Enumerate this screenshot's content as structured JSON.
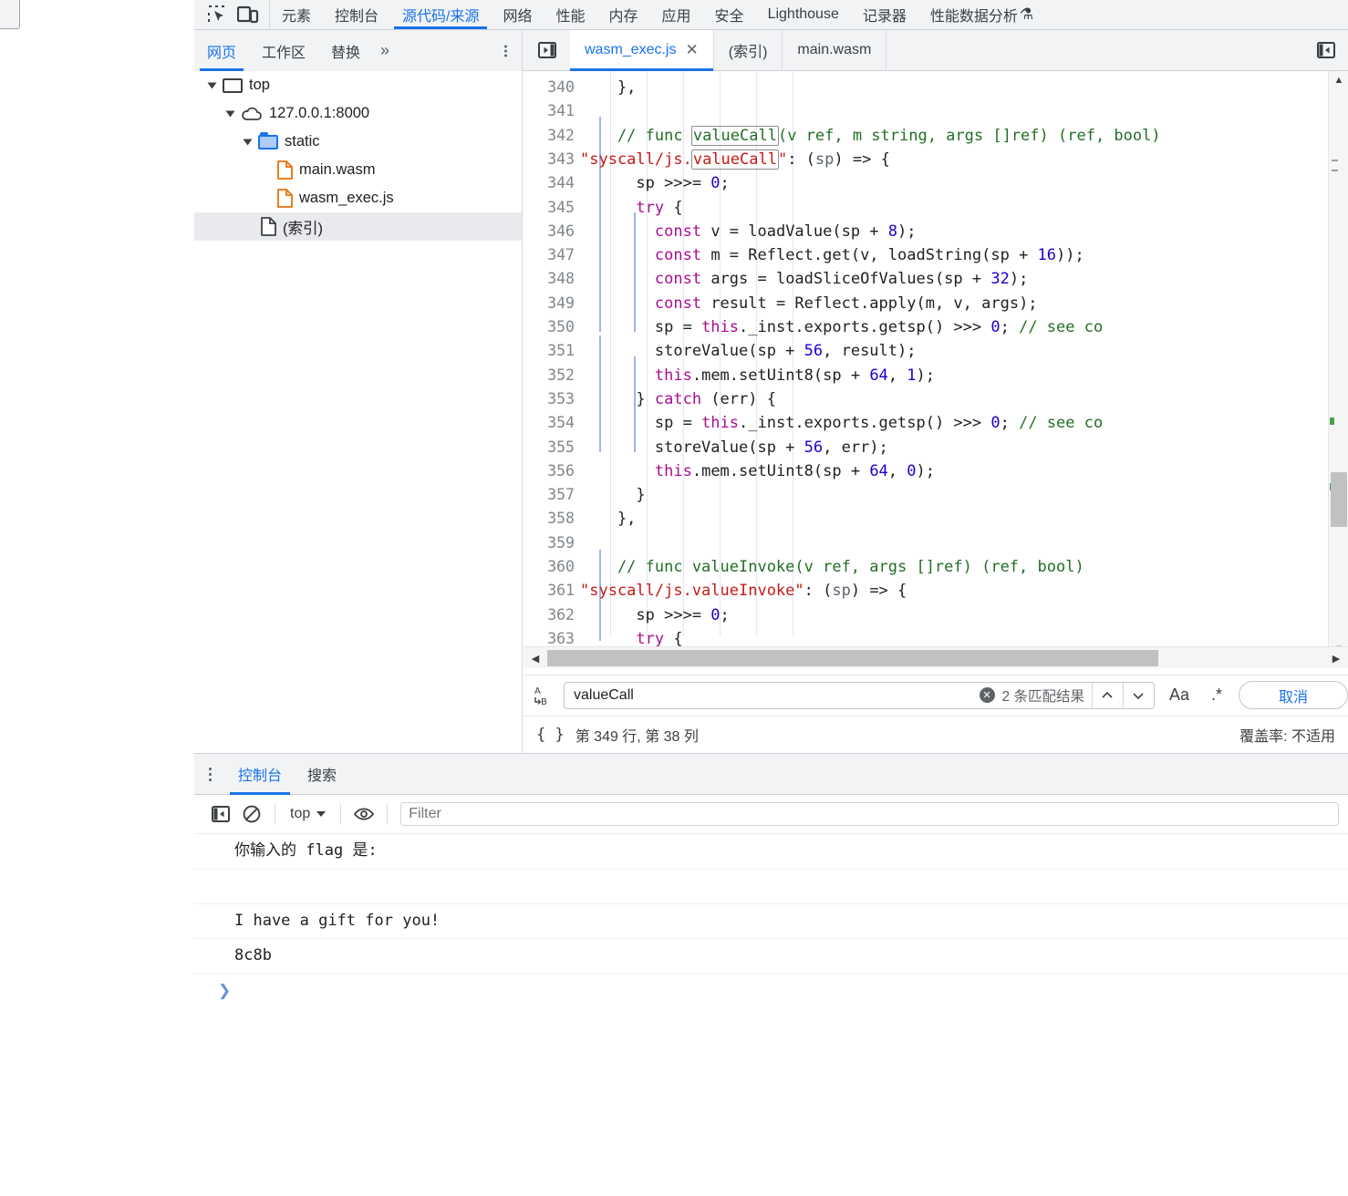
{
  "main_tabs": {
    "icons": [
      "inspect-element-icon",
      "device-toolbar-icon"
    ],
    "items": [
      {
        "label": "元素",
        "selected": false
      },
      {
        "label": "控制台",
        "selected": false
      },
      {
        "label": "源代码/来源",
        "selected": true
      },
      {
        "label": "网络",
        "selected": false
      },
      {
        "label": "性能",
        "selected": false
      },
      {
        "label": "内存",
        "selected": false
      },
      {
        "label": "应用",
        "selected": false
      },
      {
        "label": "安全",
        "selected": false
      },
      {
        "label": "Lighthouse",
        "selected": false
      },
      {
        "label": "记录器",
        "selected": false
      },
      {
        "label": "性能数据分析",
        "selected": false
      }
    ],
    "flask_glyph": "⚗"
  },
  "navigator": {
    "tabs": [
      {
        "label": "网页",
        "selected": true
      },
      {
        "label": "工作区",
        "selected": false
      },
      {
        "label": "替换",
        "selected": false
      }
    ],
    "more_glyph": "»",
    "tree": [
      {
        "label": "top",
        "icon": "frame-icon",
        "indent": 0,
        "expanded": true,
        "selected": false
      },
      {
        "label": "127.0.0.1:8000",
        "icon": "cloud-icon",
        "indent": 1,
        "expanded": true,
        "selected": false
      },
      {
        "label": "static",
        "icon": "folder-icon",
        "indent": 2,
        "expanded": true,
        "selected": false
      },
      {
        "label": "main.wasm",
        "icon": "file-orange-icon",
        "indent": 3,
        "expanded": false,
        "selected": false
      },
      {
        "label": "wasm_exec.js",
        "icon": "file-orange-icon",
        "indent": 3,
        "expanded": false,
        "selected": false
      },
      {
        "label": "(索引)",
        "icon": "file-gray-icon",
        "indent": 2,
        "expanded": false,
        "selected": true
      }
    ]
  },
  "editor": {
    "tabs": [
      {
        "label": "wasm_exec.js",
        "selected": true,
        "closable": true
      },
      {
        "label": "(索引)",
        "selected": false,
        "closable": false
      },
      {
        "label": "main.wasm",
        "selected": false,
        "closable": false
      }
    ],
    "close_glyph": "✕",
    "first_line": 340,
    "lines": [
      {
        "n": 340,
        "tokens": [
          {
            "t": "    },",
            "c": "pln"
          }
        ]
      },
      {
        "n": 341,
        "tokens": []
      },
      {
        "n": 342,
        "tokens": [
          {
            "t": "    // func ",
            "c": "cmt"
          },
          {
            "t": "valueCall",
            "c": "cmt mark"
          },
          {
            "t": "(v ref, m string, args []ref) (ref, bool)",
            "c": "cmt"
          }
        ]
      },
      {
        "n": 343,
        "tokens": [
          {
            "t": "\"syscall/js.",
            "c": "str"
          },
          {
            "t": "valueCall",
            "c": "str mark"
          },
          {
            "t": "\"",
            "c": "str"
          },
          {
            "t": ": (",
            "c": "pln"
          },
          {
            "t": "sp",
            "c": "par"
          },
          {
            "t": ") => {",
            "c": "pln"
          }
        ]
      },
      {
        "n": 344,
        "tokens": [
          {
            "t": "      sp >>>= ",
            "c": "pln"
          },
          {
            "t": "0",
            "c": "num"
          },
          {
            "t": ";",
            "c": "pln"
          }
        ]
      },
      {
        "n": 345,
        "tokens": [
          {
            "t": "      ",
            "c": "pln"
          },
          {
            "t": "try",
            "c": "kw"
          },
          {
            "t": " {",
            "c": "pln"
          }
        ]
      },
      {
        "n": 346,
        "tokens": [
          {
            "t": "        ",
            "c": "pln"
          },
          {
            "t": "const",
            "c": "kw"
          },
          {
            "t": " v = loadValue(sp + ",
            "c": "pln"
          },
          {
            "t": "8",
            "c": "num"
          },
          {
            "t": ");",
            "c": "pln"
          }
        ]
      },
      {
        "n": 347,
        "tokens": [
          {
            "t": "        ",
            "c": "pln"
          },
          {
            "t": "const",
            "c": "kw"
          },
          {
            "t": " m = Reflect.get(v, loadString(sp + ",
            "c": "pln"
          },
          {
            "t": "16",
            "c": "num"
          },
          {
            "t": "));",
            "c": "pln"
          }
        ]
      },
      {
        "n": 348,
        "tokens": [
          {
            "t": "        ",
            "c": "pln"
          },
          {
            "t": "const",
            "c": "kw"
          },
          {
            "t": " args = loadSliceOfValues(sp + ",
            "c": "pln"
          },
          {
            "t": "32",
            "c": "num"
          },
          {
            "t": ");",
            "c": "pln"
          }
        ]
      },
      {
        "n": 349,
        "tokens": [
          {
            "t": "        ",
            "c": "pln"
          },
          {
            "t": "const",
            "c": "kw"
          },
          {
            "t": " result = Reflect.apply(m, v, args);",
            "c": "pln"
          }
        ]
      },
      {
        "n": 350,
        "tokens": [
          {
            "t": "        sp = ",
            "c": "pln"
          },
          {
            "t": "this",
            "c": "kw"
          },
          {
            "t": "._inst.exports.getsp() >>> ",
            "c": "pln"
          },
          {
            "t": "0",
            "c": "num"
          },
          {
            "t": "; ",
            "c": "pln"
          },
          {
            "t": "// see co",
            "c": "cmt"
          }
        ]
      },
      {
        "n": 351,
        "tokens": [
          {
            "t": "        storeValue(sp + ",
            "c": "pln"
          },
          {
            "t": "56",
            "c": "num"
          },
          {
            "t": ", result);",
            "c": "pln"
          }
        ]
      },
      {
        "n": 352,
        "tokens": [
          {
            "t": "        ",
            "c": "pln"
          },
          {
            "t": "this",
            "c": "kw"
          },
          {
            "t": ".mem.setUint8(sp + ",
            "c": "pln"
          },
          {
            "t": "64",
            "c": "num"
          },
          {
            "t": ", ",
            "c": "pln"
          },
          {
            "t": "1",
            "c": "num"
          },
          {
            "t": ");",
            "c": "pln"
          }
        ]
      },
      {
        "n": 353,
        "tokens": [
          {
            "t": "      } ",
            "c": "pln"
          },
          {
            "t": "catch",
            "c": "kw"
          },
          {
            "t": " (err) {",
            "c": "pln"
          }
        ]
      },
      {
        "n": 354,
        "tokens": [
          {
            "t": "        sp = ",
            "c": "pln"
          },
          {
            "t": "this",
            "c": "kw"
          },
          {
            "t": "._inst.exports.getsp() >>> ",
            "c": "pln"
          },
          {
            "t": "0",
            "c": "num"
          },
          {
            "t": "; ",
            "c": "pln"
          },
          {
            "t": "// see co",
            "c": "cmt"
          }
        ]
      },
      {
        "n": 355,
        "tokens": [
          {
            "t": "        storeValue(sp + ",
            "c": "pln"
          },
          {
            "t": "56",
            "c": "num"
          },
          {
            "t": ", err);",
            "c": "pln"
          }
        ]
      },
      {
        "n": 356,
        "tokens": [
          {
            "t": "        ",
            "c": "pln"
          },
          {
            "t": "this",
            "c": "kw"
          },
          {
            "t": ".mem.setUint8(sp + ",
            "c": "pln"
          },
          {
            "t": "64",
            "c": "num"
          },
          {
            "t": ", ",
            "c": "pln"
          },
          {
            "t": "0",
            "c": "num"
          },
          {
            "t": ");",
            "c": "pln"
          }
        ]
      },
      {
        "n": 357,
        "tokens": [
          {
            "t": "      }",
            "c": "pln"
          }
        ]
      },
      {
        "n": 358,
        "tokens": [
          {
            "t": "    },",
            "c": "pln"
          }
        ]
      },
      {
        "n": 359,
        "tokens": []
      },
      {
        "n": 360,
        "tokens": [
          {
            "t": "    // func valueInvoke(v ref, args []ref) (ref, bool)",
            "c": "cmt"
          }
        ]
      },
      {
        "n": 361,
        "tokens": [
          {
            "t": "\"syscall/js.valueInvoke\"",
            "c": "str"
          },
          {
            "t": ": (",
            "c": "pln"
          },
          {
            "t": "sp",
            "c": "par"
          },
          {
            "t": ") => {",
            "c": "pln"
          }
        ]
      },
      {
        "n": 362,
        "tokens": [
          {
            "t": "      sp >>>= ",
            "c": "pln"
          },
          {
            "t": "0",
            "c": "num"
          },
          {
            "t": ";",
            "c": "pln"
          }
        ]
      },
      {
        "n": 363,
        "tokens": [
          {
            "t": "      ",
            "c": "pln"
          },
          {
            "t": "try",
            "c": "kw"
          },
          {
            "t": " {",
            "c": "pln"
          }
        ]
      }
    ]
  },
  "search": {
    "icon_top": "A",
    "icon_bottom": "B",
    "value": "valueCall",
    "placeholder": "",
    "clear_glyph": "✕",
    "match_count": "2 条匹配结果",
    "prev_glyph": "⌃",
    "next_glyph": "⌄",
    "match_case_label": "Aa",
    "regex_label": ".*",
    "cancel_label": "取消"
  },
  "status": {
    "format_glyph": "{ }",
    "position": "第 349 行, 第 38 列",
    "coverage": "覆盖率: 不适用"
  },
  "drawer": {
    "tabs": [
      {
        "label": "控制台",
        "selected": true
      },
      {
        "label": "搜索",
        "selected": false
      }
    ],
    "toolbar": {
      "sidebar_toggle": "sidebar-toggle-icon",
      "clear": "clear-console-icon",
      "context": "top",
      "eye": "live-expression-icon",
      "filter_placeholder": "Filter",
      "filter_value": ""
    },
    "messages": [
      {
        "text": "你输入的 flag 是:",
        "blank": false
      },
      {
        "text": "",
        "blank": true
      },
      {
        "text": "I have a gift for you!",
        "blank": false
      },
      {
        "text": "8c8b",
        "blank": false
      }
    ],
    "prompt_glyph": "❯"
  },
  "colors": {
    "accent": "#1a73e8",
    "toolbar_bg": "#f1f3f4",
    "comment": "#236e25",
    "string": "#c41a16",
    "keyword": "#aa0d91",
    "number": "#1c00cf",
    "match_marker": "#4c9f4c"
  }
}
